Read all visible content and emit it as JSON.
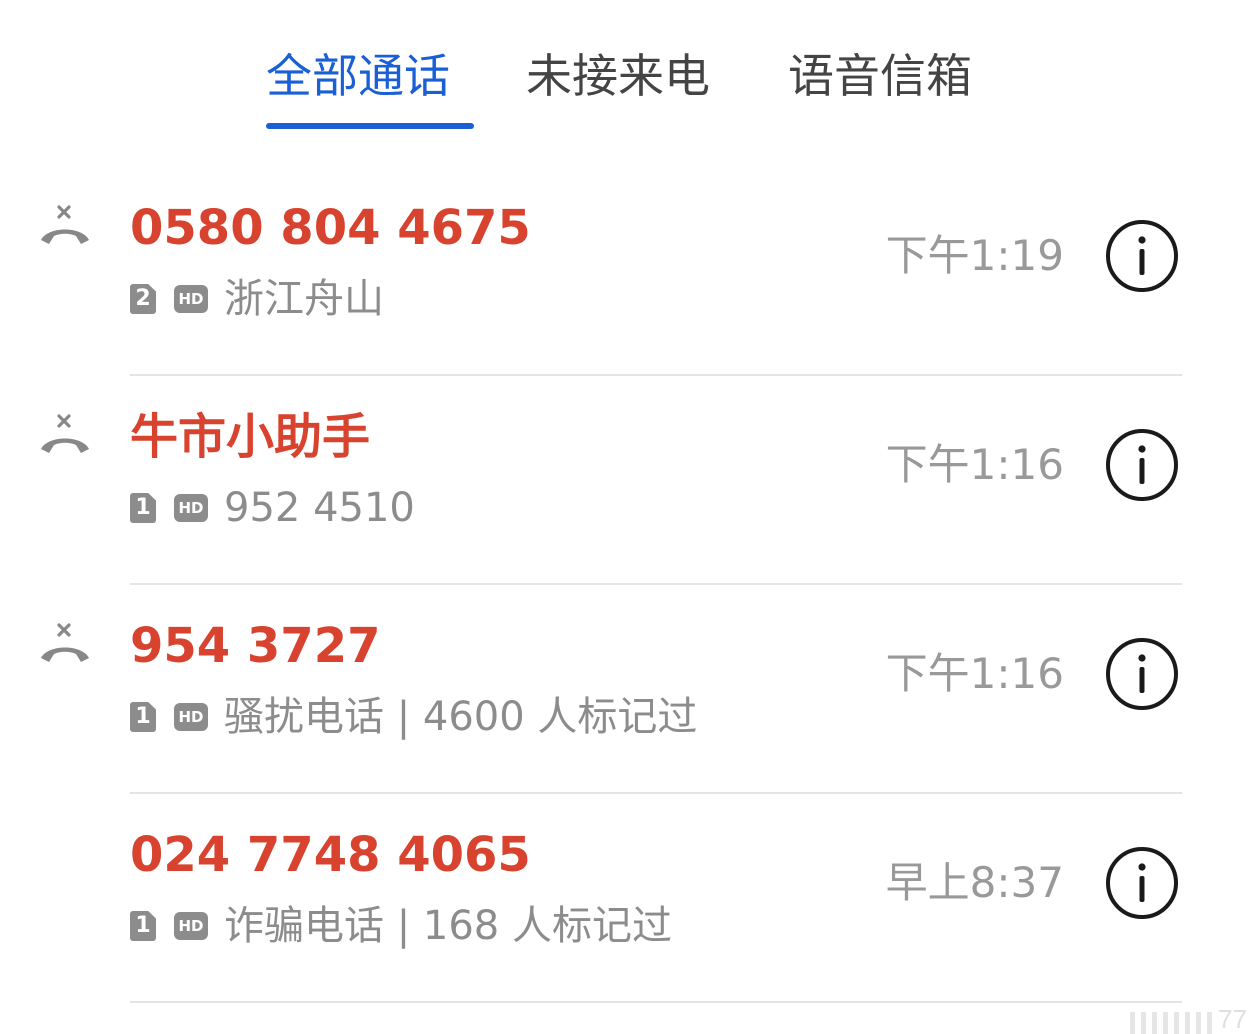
{
  "tabs": [
    {
      "label": "全部通话",
      "active": true
    },
    {
      "label": "未接来电",
      "active": false
    },
    {
      "label": "语音信箱",
      "active": false
    }
  ],
  "colors": {
    "accent": "#1a5fd6",
    "missed": "#d8432f",
    "secondary_text": "#8c8c8c",
    "time_text": "#999999"
  },
  "calls": [
    {
      "caller": "0580 804 4675",
      "sim": "2",
      "hd": "HD",
      "detail": "浙江舟山",
      "time": "下午1:19",
      "missed_icon": true
    },
    {
      "caller": "牛市小助手",
      "sim": "1",
      "hd": "HD",
      "detail": "952 4510",
      "time": "下午1:16",
      "missed_icon": true
    },
    {
      "caller": "954 3727",
      "sim": "1",
      "hd": "HD",
      "detail": "骚扰电话 | 4600 人标记过",
      "time": "下午1:16",
      "missed_icon": true
    },
    {
      "caller": "024 7748 4065",
      "sim": "1",
      "hd": "HD",
      "detail": "诈骗电话 | 168 人标记过",
      "time": "早上8:37",
      "missed_icon": false
    }
  ],
  "icons": {
    "missed": "missed-call-icon",
    "info": "info-icon"
  },
  "watermark": {
    "text": "77"
  }
}
